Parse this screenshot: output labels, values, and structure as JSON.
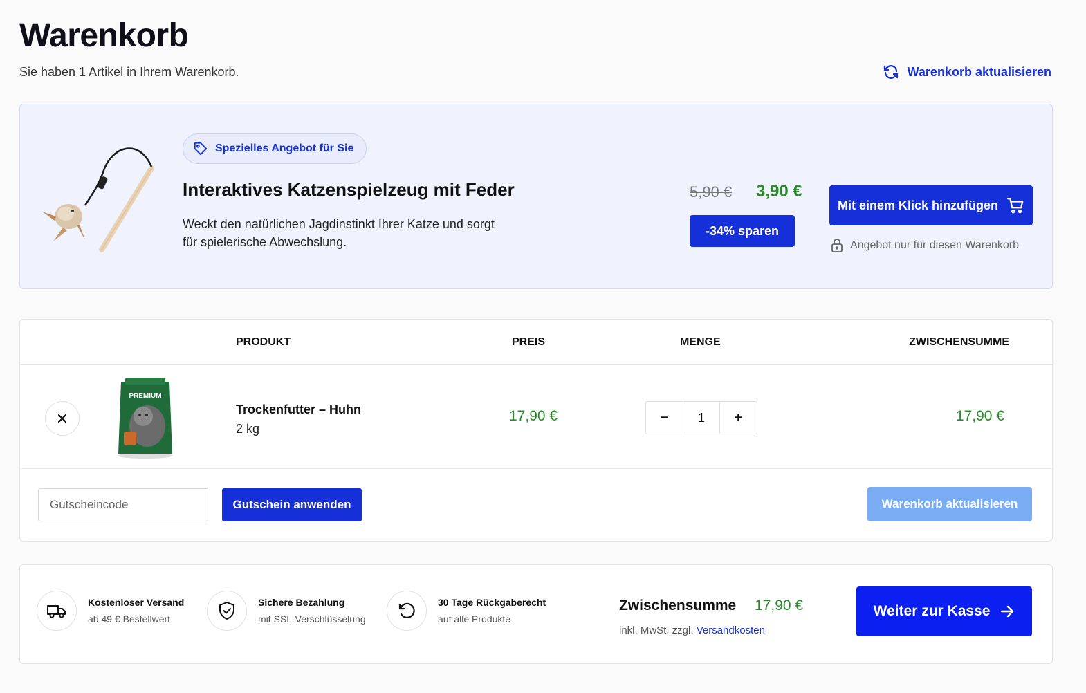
{
  "header": {
    "title": "Warenkorb",
    "subtitle": "Sie haben 1 Artikel in Ihrem Warenkorb.",
    "refresh_link": "Warenkorb aktualisieren"
  },
  "offer": {
    "badge": "Spezielles Angebot für Sie",
    "title": "Interaktives Katzenspielzeug mit Feder",
    "description": "Weckt den natürlichen Jagdinstinkt Ihrer Katze und sorgt für spielerische Abwechslung.",
    "old_price": "5,90 €",
    "new_price": "3,90 €",
    "save_label": "-34% sparen",
    "button_label": "Mit einem Klick hinzufügen",
    "note": "Angebot nur für diesen Warenkorb"
  },
  "cart": {
    "columns": [
      "PRODUKT",
      "PREIS",
      "MENGE",
      "ZWISCHENSUMME"
    ],
    "items": [
      {
        "name": "Trockenfutter – Huhn",
        "variant": "2 kg",
        "price": "17,90 €",
        "quantity": "1",
        "subtotal": "17,90 €",
        "image_label": "PREMIUM"
      }
    ],
    "coupon_placeholder": "Gutscheincode",
    "coupon_button": "Gutschein anwenden",
    "update_button": "Warenkorb aktualisieren"
  },
  "features": [
    {
      "title": "Kostenloser Versand",
      "sub": "ab 49 € Bestellwert",
      "icon": "truck-icon"
    },
    {
      "title": "Sichere Bezahlung",
      "sub": "mit SSL-Verschlüsselung",
      "icon": "shield-check-icon"
    },
    {
      "title": "30 Tage Rückgaberecht",
      "sub": "auf alle Produkte",
      "icon": "return-icon"
    }
  ],
  "summary": {
    "label": "Zwischensumme",
    "value": "17,90 €",
    "tax_prefix": "inkl. MwSt. zzgl.",
    "tax_link": "Versandkosten",
    "checkout_button": "Weiter zur Kasse"
  },
  "colors": {
    "primary": "#1530d8",
    "price_green": "#2a8a2a",
    "offer_bg": "#f0f3fd",
    "update_button_disabled": "#79acf3"
  }
}
